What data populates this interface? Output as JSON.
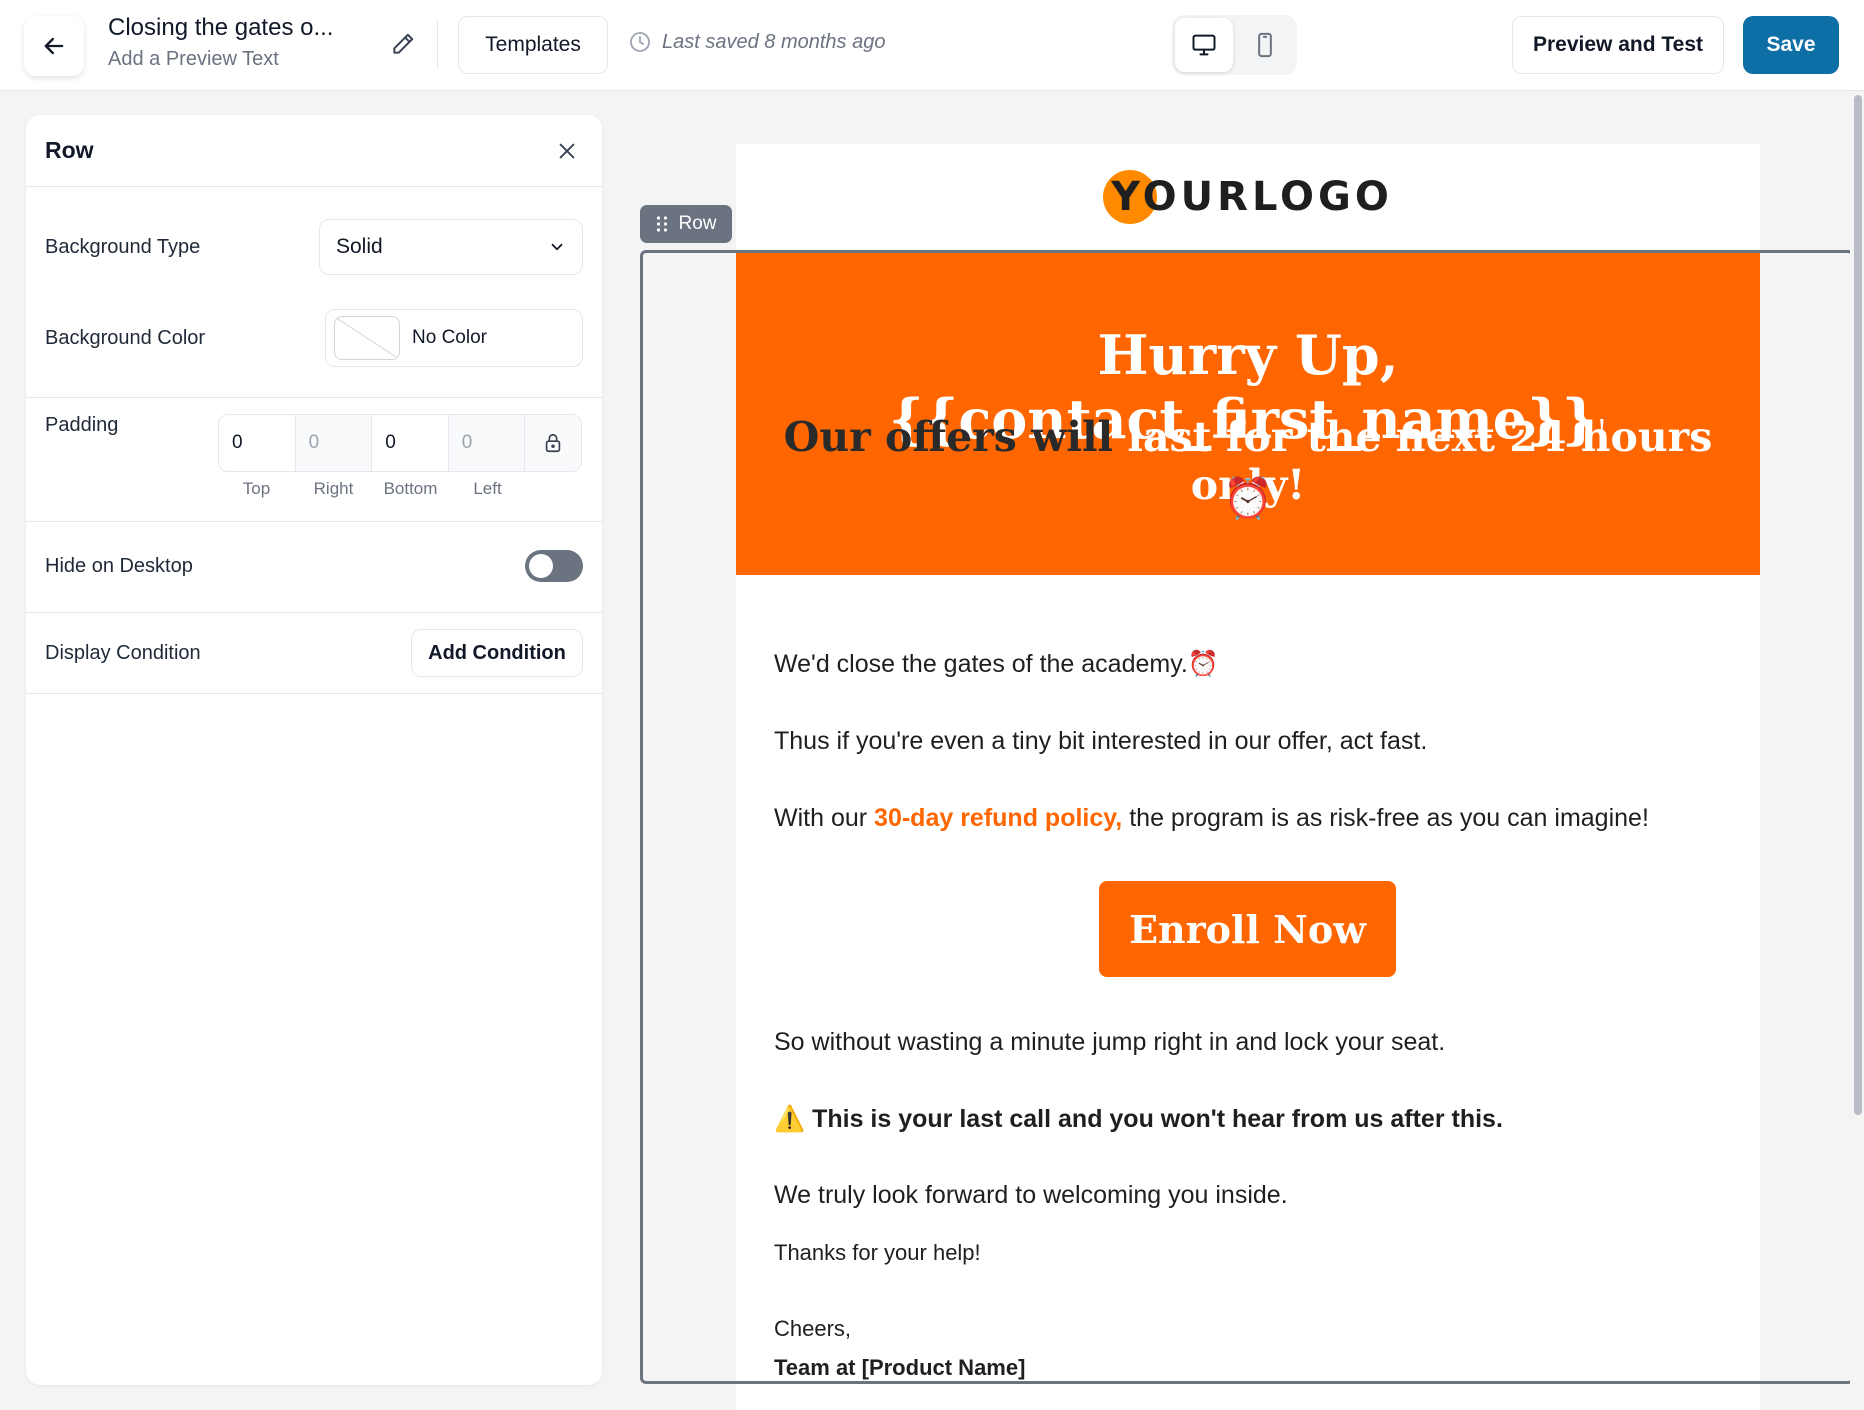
{
  "header": {
    "title": "Closing the gates o...",
    "preview_text": "Add a Preview Text",
    "templates_label": "Templates",
    "last_saved": "Last saved 8 months ago",
    "preview_label": "Preview and Test",
    "save_label": "Save",
    "device_modes": [
      "desktop",
      "mobile"
    ],
    "active_device": "desktop"
  },
  "panel": {
    "title": "Row",
    "background_type_label": "Background Type",
    "background_type_value": "Solid",
    "background_color_label": "Background Color",
    "background_color_value": "No Color",
    "padding_label": "Padding",
    "padding": {
      "top": "0",
      "right": "0",
      "bottom": "0",
      "left": "0",
      "top_label": "Top",
      "right_label": "Right",
      "bottom_label": "Bottom",
      "left_label": "Left"
    },
    "hide_desktop_label": "Hide on Desktop",
    "hide_desktop_enabled": false,
    "display_condition_label": "Display Condition",
    "add_condition_label": "Add Condition"
  },
  "email": {
    "logo": "YOURLOGO",
    "row_tag": "Row",
    "hero_title": "Hurry Up, {{contact_first_name}}",
    "hero_title_suffix": "!",
    "hero_sub_dark": "Our offers will",
    "hero_sub_light": "last for the next 24 hours only!",
    "hero_emoji": "⏰",
    "p1": "We'd close the gates of the academy.⏰",
    "p2": "Thus if you're even a tiny bit interested in our offer, act fast.",
    "p3_before": "With our",
    "p3_accent": "30-day refund policy,",
    "p3_after": "the program is as risk-free as you can imagine!",
    "cta": "Enroll Now",
    "p4": "So without wasting a minute jump right in and lock your seat.",
    "p5_icon": "⚠️",
    "p5": "This is your last call and you won't hear from us after this.",
    "p6": "We truly look forward to welcoming you inside.",
    "p7": "Thanks for your help!",
    "p8": "Cheers,",
    "p9": "Team at [Product Name]"
  },
  "colors": {
    "accent": "#ff6600",
    "primary_button": "#0e6ea6",
    "logo_circle": "#ff8a00"
  }
}
